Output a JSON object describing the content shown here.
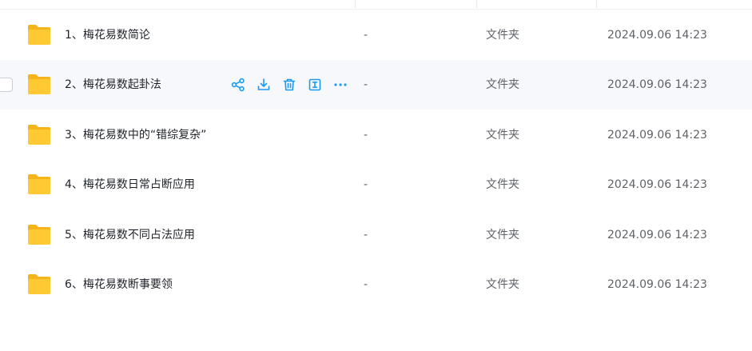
{
  "colors": {
    "accent": "#1b9aee",
    "folder_front": "#ffc933",
    "folder_back": "#f5b51a",
    "hover_row_bg": "#f6f8fb"
  },
  "files": [
    {
      "name": "1、梅花易数简论",
      "size": "-",
      "type": "文件夹",
      "modified": "2024.09.06 14:23"
    },
    {
      "name": "2、梅花易数起卦法",
      "size": "-",
      "type": "文件夹",
      "modified": "2024.09.06 14:23"
    },
    {
      "name": "3、梅花易数中的“错综复杂”",
      "size": "-",
      "type": "文件夹",
      "modified": "2024.09.06 14:23"
    },
    {
      "name": "4、梅花易数日常占断应用",
      "size": "-",
      "type": "文件夹",
      "modified": "2024.09.06 14:23"
    },
    {
      "name": "5、梅花易数不同占法应用",
      "size": "-",
      "type": "文件夹",
      "modified": "2024.09.06 14:23"
    },
    {
      "name": "6、梅花易数断事要领",
      "size": "-",
      "type": "文件夹",
      "modified": "2024.09.06 14:23"
    }
  ],
  "hover_actions": [
    "share-icon",
    "download-icon",
    "delete-icon",
    "rename-icon",
    "more-icon"
  ]
}
